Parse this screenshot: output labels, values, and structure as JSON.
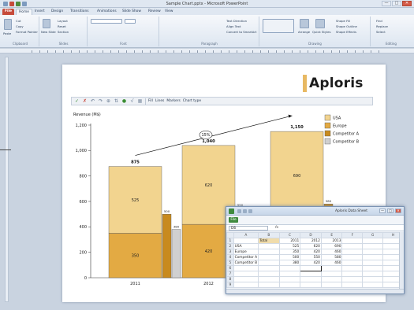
{
  "window": {
    "title": "Sample Chart.pptx - Microsoft PowerPoint",
    "buttons": [
      "—",
      "□",
      "✕"
    ]
  },
  "ribbon": {
    "tabs": [
      "File",
      "Home",
      "Insert",
      "Design",
      "Transitions",
      "Animations",
      "Slide Show",
      "Review",
      "View"
    ],
    "active_tab": "Home",
    "clipboard": {
      "paste": "Paste",
      "cut": "Cut",
      "copy": "Copy",
      "format_painter": "Format Painter",
      "label": "Clipboard"
    },
    "slides": {
      "new_slide": "New Slide",
      "layout": "Layout",
      "reset": "Reset",
      "section": "Section",
      "label": "Slides"
    },
    "font": {
      "label": "Font"
    },
    "paragraph": {
      "text_direction": "Text Direction",
      "align_text": "Align Text",
      "convert_smartart": "Convert to SmartArt",
      "label": "Paragraph"
    },
    "drawing": {
      "arrange": "Arrange",
      "quick_styles": "Quick Styles",
      "shape_fill": "Shape Fill",
      "shape_outline": "Shape Outline",
      "shape_effects": "Shape Effects",
      "label": "Drawing"
    },
    "editing": {
      "find": "Find",
      "replace": "Replace",
      "select": "Select",
      "label": "Editing"
    }
  },
  "slide": {
    "logo": "Aploris"
  },
  "think_toolbar": {
    "fill": "Fill",
    "lines": "Lines",
    "markers": "Markers",
    "chart_type": "Chart type"
  },
  "chart_data": {
    "type": "bar",
    "ylabel": "Revenue (M$)",
    "ylim": [
      0,
      1200
    ],
    "yticks": [
      "0",
      "200",
      "400",
      "600",
      "800",
      "1,000",
      "1,200"
    ],
    "categories": [
      "2011",
      "2012",
      "2013"
    ],
    "stacked_series": [
      {
        "name": "USA",
        "color": "#f2d48f",
        "values": [
          525,
          620,
          690
        ]
      },
      {
        "name": "Europe",
        "color": "#e3aa43",
        "values": [
          350,
          420,
          460
        ]
      }
    ],
    "side_series": [
      {
        "name": "Competitor A",
        "color": "#c88a1e",
        "values": [
          500,
          550,
          580
        ]
      },
      {
        "name": "Competitor B",
        "color": "#d0d0d0",
        "values": [
          380,
          420,
          460
        ]
      }
    ],
    "totals": [
      "875",
      "1,040",
      "1,150"
    ],
    "cagr_label": "15%",
    "legend": [
      "USA",
      "Europe",
      "Competitor A",
      "Competitor B"
    ]
  },
  "datasheet": {
    "title": "Aploris Data Sheet",
    "file_tab": "File",
    "name_box": "D6",
    "fx": "fx",
    "col_headers": [
      "",
      "A",
      "B",
      "C",
      "D",
      "E",
      "F",
      "G",
      "H"
    ],
    "rows": [
      [
        "1",
        "",
        "Total",
        "2011",
        "2012",
        "2013",
        "",
        "",
        ""
      ],
      [
        "2",
        "USA",
        "",
        "525",
        "620",
        "690",
        "",
        "",
        ""
      ],
      [
        "3",
        "Europe",
        "",
        "350",
        "420",
        "460",
        "",
        "",
        ""
      ],
      [
        "4",
        "Competitor A",
        "",
        "500",
        "550",
        "580",
        "",
        "",
        ""
      ],
      [
        "5",
        "Competitor B",
        "",
        "380",
        "420",
        "460",
        "",
        "",
        ""
      ],
      [
        "6",
        "",
        "",
        "",
        "",
        "",
        "",
        "",
        ""
      ],
      [
        "7",
        "",
        "",
        "",
        "",
        "",
        "",
        "",
        ""
      ],
      [
        "8",
        "",
        "",
        "",
        "",
        "",
        "",
        "",
        ""
      ],
      [
        "9",
        "",
        "",
        "",
        "",
        "",
        "",
        "",
        ""
      ]
    ]
  }
}
